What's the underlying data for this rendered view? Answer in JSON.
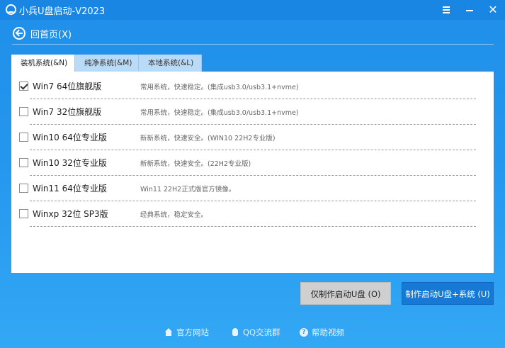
{
  "window": {
    "title": "小兵U盘启动-V2023",
    "menu_icon": "menu-icon",
    "minimize_icon": "minimize-icon",
    "close_icon": "close-icon",
    "close_label": "✕"
  },
  "nav": {
    "back_label": "回首页(X)",
    "back_icon": "back-arrow-icon"
  },
  "tabs": [
    {
      "label": "装机系统(&N)",
      "active": true
    },
    {
      "label": "纯净系统(&M)",
      "active": false
    },
    {
      "label": "本地系统(&L)",
      "active": false
    }
  ],
  "systems": [
    {
      "name": "Win7 64位旗舰版",
      "desc": "常用系统，快速稳定。(集成usb3.0/usb3.1+nvme)",
      "checked": true
    },
    {
      "name": "Win7 32位旗舰版",
      "desc": "常用系统，快速稳定。(集成usb3.0/usb3.1+nvme)",
      "checked": false
    },
    {
      "name": "Win10 64位专业版",
      "desc": "新新系统，快速安全。(WIN10 22H2专业版)",
      "checked": false
    },
    {
      "name": "Win10 32位专业版",
      "desc": "新新系统，快速安全。(22H2专业版)",
      "checked": false
    },
    {
      "name": "Win11 64位专业版",
      "desc": "Win11 22H2正式版官方镜像。",
      "checked": false
    },
    {
      "name": "Winxp 32位 SP3版",
      "desc": "经典系统，稳定安全。",
      "checked": false
    }
  ],
  "buttons": {
    "usb_only": "仅制作启动U盘 (O)",
    "usb_system": "制作启动U盘+系统 (U)"
  },
  "footer": {
    "website": "官方网站",
    "qq": "QQ交流群",
    "help": "帮助视频",
    "help_glyph": "?"
  },
  "colors": {
    "background": "#2596ee",
    "primary_button": "#1679d6",
    "secondary_button": "#cfcfcf"
  }
}
